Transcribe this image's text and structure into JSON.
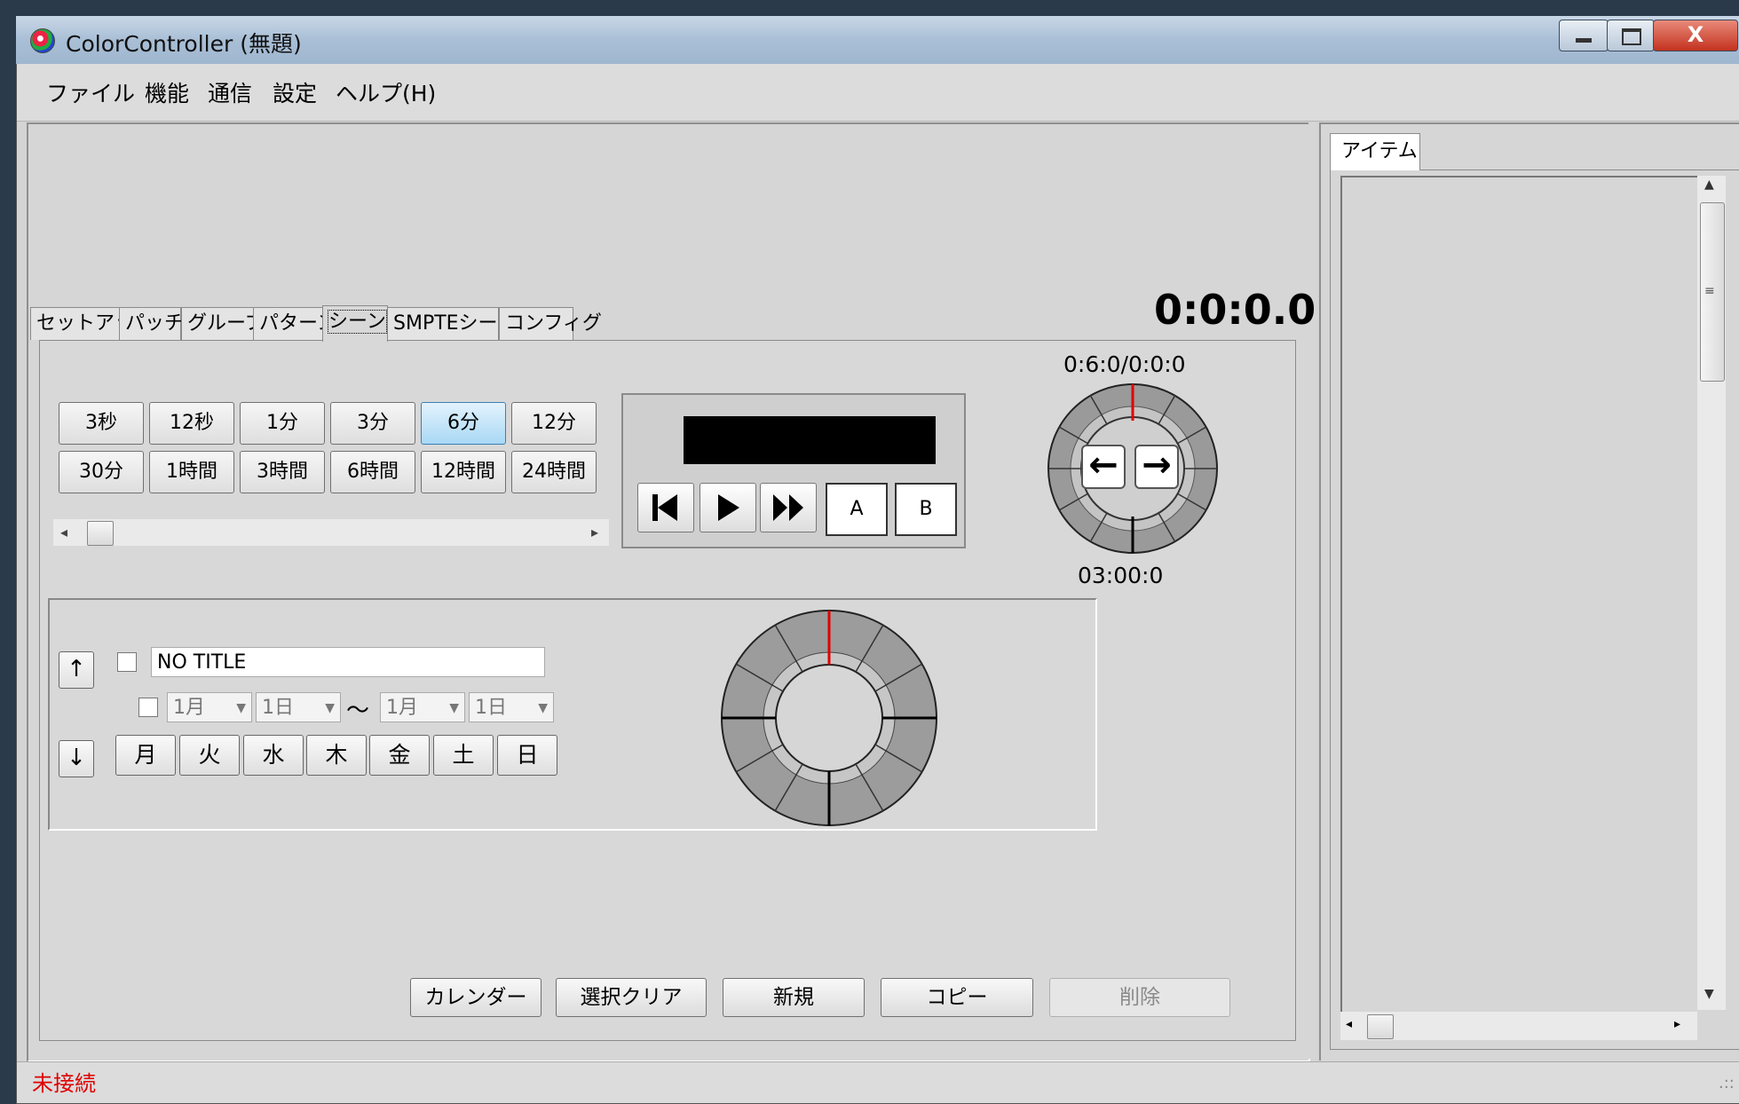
{
  "window": {
    "title": "ColorController (無題)",
    "close_glyph": "X"
  },
  "menu": [
    "ファイル",
    "機能",
    "通信",
    "設定",
    "ヘルプ(H)"
  ],
  "tabs": [
    "セットアップ",
    "パッチ",
    "グループ",
    "パターン",
    "シーン",
    "SMPTEシーン",
    "コンフィグ"
  ],
  "active_tab": "シーン",
  "main_time": "0:0:0.0",
  "durations": {
    "row1": [
      "3秒",
      "12秒",
      "1分",
      "3分",
      "6分",
      "12分"
    ],
    "row2": [
      "30分",
      "1時間",
      "3時間",
      "6時間",
      "12時間",
      "24時間"
    ],
    "selected": "6分"
  },
  "transport": {
    "a_label": "A",
    "b_label": "B"
  },
  "small_ring": {
    "top_label": "0:6:0/0:0:0",
    "bottom_label": "03:00:0",
    "left_arrow": "←",
    "right_arrow": "→"
  },
  "schedule": {
    "up_arrow": "↑",
    "down_arrow": "↓",
    "title_value": "NO TITLE",
    "from_month": "1月",
    "from_day": "1日",
    "tilde": "～",
    "to_month": "1月",
    "to_day": "1日",
    "weekdays": [
      "月",
      "火",
      "水",
      "木",
      "金",
      "土",
      "日"
    ]
  },
  "bottom_buttons": [
    "カレンダー",
    "選択クリア",
    "新規",
    "コピー",
    "削除"
  ],
  "right_panel": {
    "tab": "アイテム"
  },
  "status": {
    "text": "未接続",
    "color": "#e00000"
  },
  "colors": {
    "selected_button": "#a9d8f5",
    "ring_marker": "#e00000"
  }
}
